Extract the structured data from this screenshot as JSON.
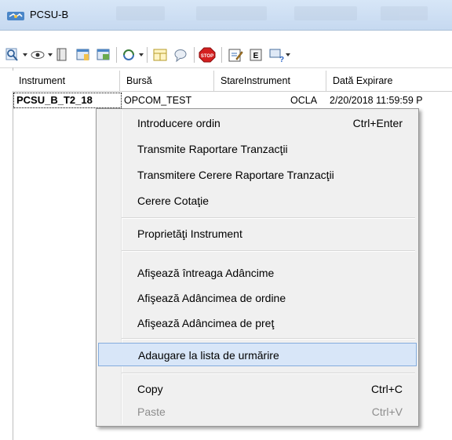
{
  "window": {
    "title": "PCSU-B"
  },
  "toolbar": {
    "icons": [
      "search-icon",
      "eye-icon",
      "book-icon",
      "window-icon",
      "window-add-icon",
      "cycle-icon",
      "layout-icon",
      "chat-icon",
      "stop-icon",
      "edit-icon",
      "e-icon",
      "help-icon"
    ],
    "stop_text": "STOP",
    "e_text": "E"
  },
  "grid": {
    "columns": [
      "Instrument",
      "Bursă",
      "StareInstrument",
      "Dată Expirare"
    ],
    "rows": [
      {
        "instrument": "PCSU_B_T2_18",
        "bursa": "OPCOM_TEST",
        "stare": "OCLA",
        "data_expirare": "2/20/2018 11:59:59 P"
      }
    ]
  },
  "context_menu": {
    "items": [
      {
        "label": "Introducere ordin",
        "shortcut": "Ctrl+Enter"
      },
      {
        "label": "Transmite Raportare Tranzacţii",
        "shortcut": ""
      },
      {
        "label": "Transmitere Cerere Raportare Tranzacţii",
        "shortcut": ""
      },
      {
        "label": "Cerere Cotaţie",
        "shortcut": ""
      },
      {
        "label": "Proprietăţi Instrument",
        "shortcut": ""
      },
      {
        "label": "Afişează întreaga Adâncime",
        "shortcut": ""
      },
      {
        "label": "Afişează Adâncimea de ordine",
        "shortcut": ""
      },
      {
        "label": "Afişează Adâncimea de preţ",
        "shortcut": ""
      },
      {
        "label": "Adaugare la lista de urmărire",
        "shortcut": ""
      },
      {
        "label": "Copy",
        "shortcut": "Ctrl+C"
      },
      {
        "label": "Paste",
        "shortcut": "Ctrl+V"
      }
    ],
    "highlighted_index": 8,
    "disabled_index": 10
  }
}
